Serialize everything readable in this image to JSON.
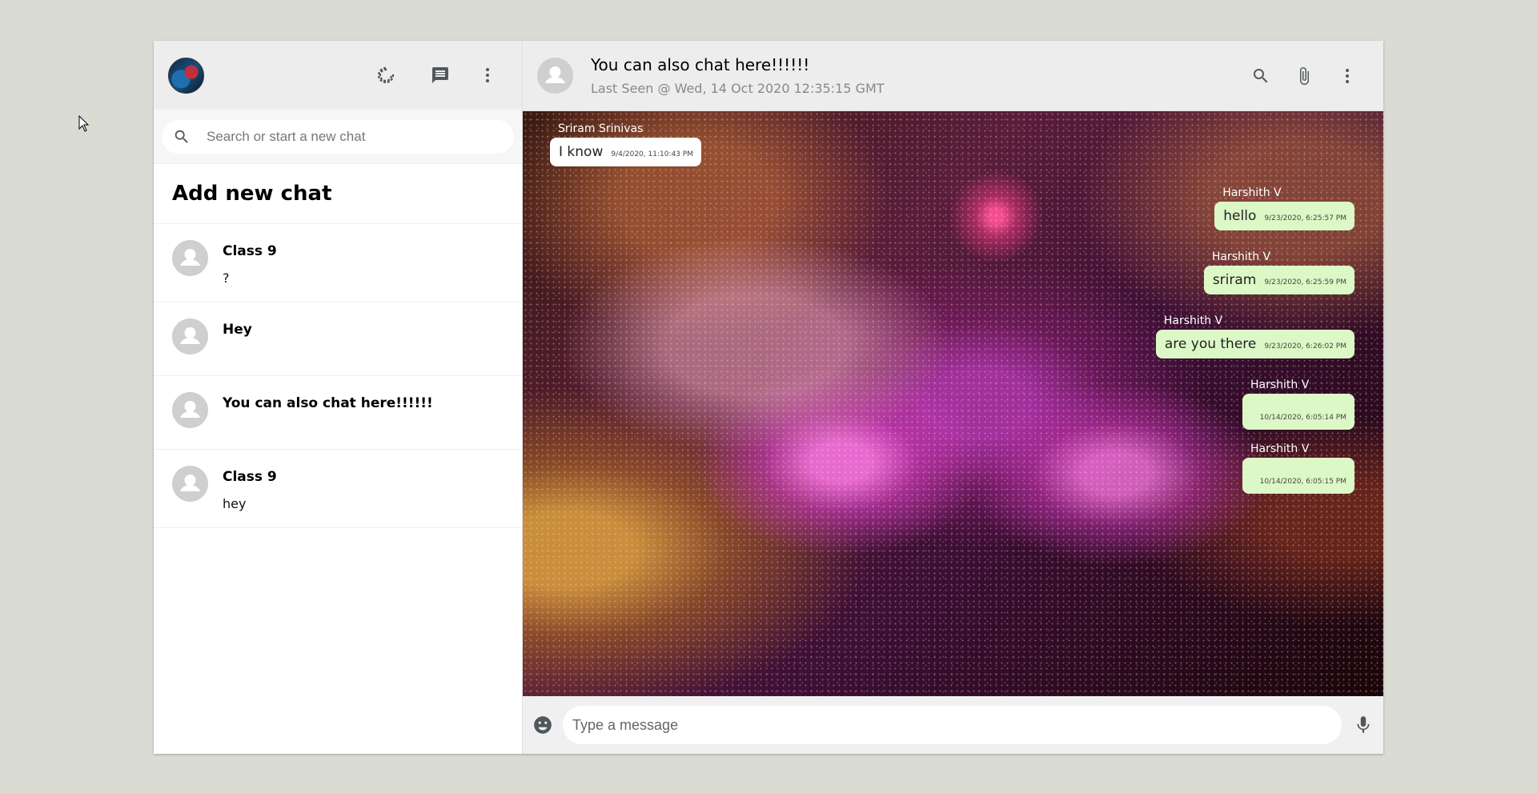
{
  "sidebar": {
    "search_placeholder": "Search or start a new chat",
    "add_chat_label": "Add new chat",
    "chats": [
      {
        "name": "Class 9",
        "last_message": "?"
      },
      {
        "name": "Hey",
        "last_message": ""
      },
      {
        "name": "You can also chat here!!!!!!",
        "last_message": ""
      },
      {
        "name": "Class 9",
        "last_message": "hey"
      }
    ],
    "icons": [
      "status-icon",
      "new-chat-icon",
      "menu-icon"
    ]
  },
  "chat_header": {
    "title": "You can also chat here!!!!!!",
    "last_seen": "Last Seen @ Wed, 14 Oct 2020 12:35:15 GMT",
    "icons": [
      "search-icon",
      "attach-icon",
      "menu-icon"
    ]
  },
  "messages": [
    {
      "sender": "Sriram Srinivas",
      "text": "I know",
      "time": "9/4/2020, 11:10:43 PM",
      "direction": "in"
    },
    {
      "sender": "Harshith V",
      "text": "hello",
      "time": "9/23/2020, 6:25:57 PM",
      "direction": "out"
    },
    {
      "sender": "Harshith V",
      "text": "sriram",
      "time": "9/23/2020, 6:25:59 PM",
      "direction": "out"
    },
    {
      "sender": "Harshith V",
      "text": "are you there",
      "time": "9/23/2020, 6:26:02 PM",
      "direction": "out"
    },
    {
      "sender": "Harshith V",
      "text": "",
      "time": "10/14/2020, 6:05:14 PM",
      "direction": "out"
    },
    {
      "sender": "Harshith V",
      "text": "",
      "time": "10/14/2020, 6:05:15 PM",
      "direction": "out"
    }
  ],
  "footer": {
    "input_placeholder": "Type a message",
    "icons": [
      "emoji-icon",
      "mic-icon"
    ]
  },
  "colors": {
    "header_bg": "#ededed",
    "outgoing_bubble": "#dcf8c6",
    "incoming_bubble": "#ffffff",
    "page_bg": "#dadbd3"
  }
}
